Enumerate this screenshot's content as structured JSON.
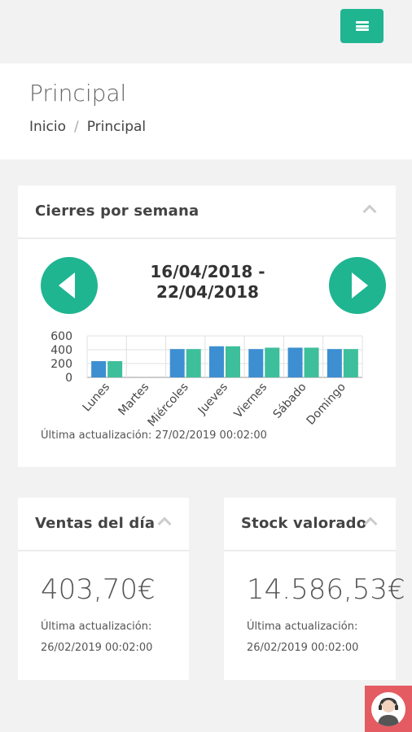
{
  "header": {
    "menu_icon": "hamburger-icon",
    "title": "Principal",
    "breadcrumb": [
      "Inicio",
      "Principal"
    ],
    "breadcrumb_separator": "/"
  },
  "weekly_card": {
    "title": "Cierres por semana",
    "date_range_line1": "16/04/2018 -",
    "date_range_line2": "22/04/2018",
    "prev_icon": "arrow-left-icon",
    "next_icon": "arrow-right-icon",
    "last_update": "Última actualización: 27/02/2019 00:02:00"
  },
  "sales_card": {
    "title": "Ventas del día",
    "value": "403,70€",
    "last_update_label": "Última actualización:",
    "last_update_value": "26/02/2019 00:02:00"
  },
  "stock_card": {
    "title": "Stock valorado",
    "value": "14.586,53€",
    "last_update_label": "Última actualización:",
    "last_update_value": "26/02/2019 00:02:00"
  },
  "help_icon": "support-avatar-icon",
  "colors": {
    "accent": "#1fb591",
    "series_a": "#3d8fd1",
    "series_b": "#3dbf9b",
    "help": "#e45b62"
  },
  "chart_data": {
    "type": "bar",
    "categories": [
      "Lunes",
      "Martes",
      "Miércoles",
      "Jueves",
      "Viernes",
      "Sábado",
      "Domingo"
    ],
    "series": [
      {
        "values": [
          235,
          0,
          410,
          450,
          410,
          430,
          410
        ]
      },
      {
        "values": [
          235,
          0,
          410,
          450,
          430,
          430,
          410
        ]
      }
    ],
    "yticks": [
      0,
      200,
      400,
      600
    ],
    "ylim": [
      0,
      600
    ],
    "grid": true
  }
}
